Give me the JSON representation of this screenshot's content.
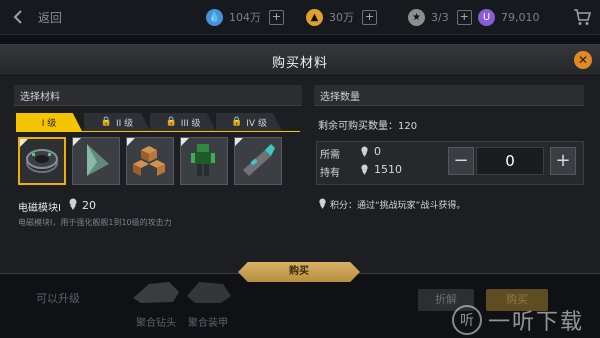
{
  "topbar": {
    "back_label": "返回",
    "resources": [
      {
        "icon": "water-drop-icon",
        "value": "104万",
        "color": "#4a90d9"
      },
      {
        "icon": "fuel-icon",
        "value": "30万",
        "color": "#e0a030"
      },
      {
        "icon": "medal-icon",
        "value": "3/3",
        "color": "#8e8e8e"
      },
      {
        "icon": "gem-icon",
        "value": "79,010",
        "color": "#8a5bd6"
      }
    ]
  },
  "modal": {
    "title": "购买材料",
    "left_panel_title": "选择材料",
    "tabs": [
      {
        "label": "I 级",
        "locked": false,
        "active": true
      },
      {
        "label": "II 级",
        "locked": true,
        "active": false
      },
      {
        "label": "III 级",
        "locked": true,
        "active": false
      },
      {
        "label": "IV 级",
        "locked": true,
        "active": false
      }
    ],
    "items": [
      {
        "icon": "electromagnetic-module-icon",
        "selected": true
      },
      {
        "icon": "prism-icon",
        "selected": false
      },
      {
        "icon": "cube-cluster-icon",
        "selected": false
      },
      {
        "icon": "robot-figure-icon",
        "selected": false
      },
      {
        "icon": "shell-casing-icon",
        "selected": false
      }
    ],
    "selected_name": "电磁模块I",
    "selected_cost": "20",
    "selected_desc": "电磁模块I，用于强化舰舰1到10级的攻击力",
    "right_panel_title": "选择数量",
    "remaining_label": "剩余可购买数量：",
    "remaining_value": "120",
    "required_label": "所需",
    "required_value": "0",
    "owned_label": "持有",
    "owned_value": "1510",
    "quantity": "0",
    "minus": "−",
    "plus": "+",
    "hint": "积分：通过“挑战玩家”战斗获得。",
    "buy_label": "购买",
    "close": "✕"
  },
  "background": {
    "upgrade_label": "可以升级",
    "items": [
      {
        "label": "聚合钻头"
      },
      {
        "label": "聚合装甲"
      }
    ],
    "grey_button": "折解",
    "gold_button": "购买"
  },
  "watermark": {
    "mark": "听",
    "text": "一听下载"
  }
}
